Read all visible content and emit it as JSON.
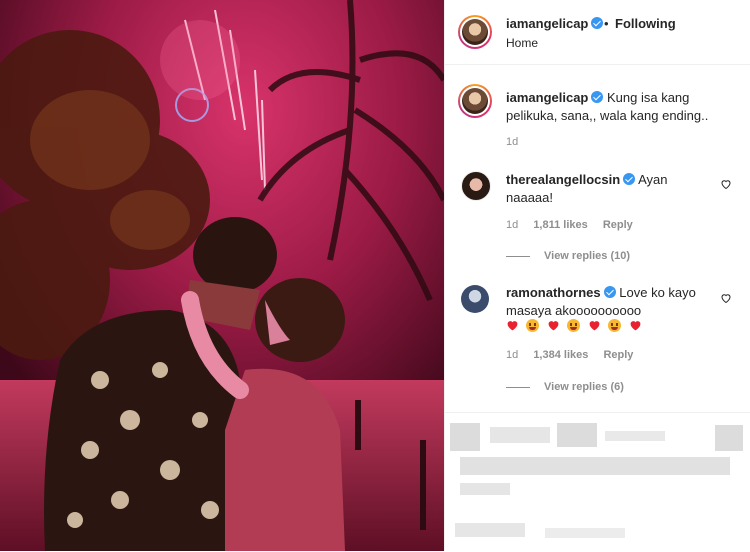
{
  "post": {
    "image": {
      "description_icon": "photo-icon"
    },
    "header": {
      "username": "iamangelicap",
      "separator": "•",
      "follow_status": "Following",
      "location": "Home"
    },
    "caption": {
      "username": "iamangelicap",
      "text": "Kung isa kang pelikuka, sana,, wala kang ending..",
      "time": "1d"
    },
    "comments": [
      {
        "username": "therealangellocsin",
        "text": "Ayan naaaaa!",
        "time": "1d",
        "likes": "1,811 likes",
        "reply_label": "Reply",
        "view_replies": "View replies (10)"
      },
      {
        "username": "ramonathornes",
        "text": "Love ko kayo masaya akoooooooooo",
        "time": "1d",
        "likes": "1,384 likes",
        "reply_label": "Reply",
        "view_replies": "View replies (6)"
      }
    ]
  },
  "colors": {
    "verified": "#3897f0",
    "muted": "#8e8e8e",
    "text": "#262626",
    "sky": "#7a0f30",
    "firework": "#ff4d8d"
  }
}
